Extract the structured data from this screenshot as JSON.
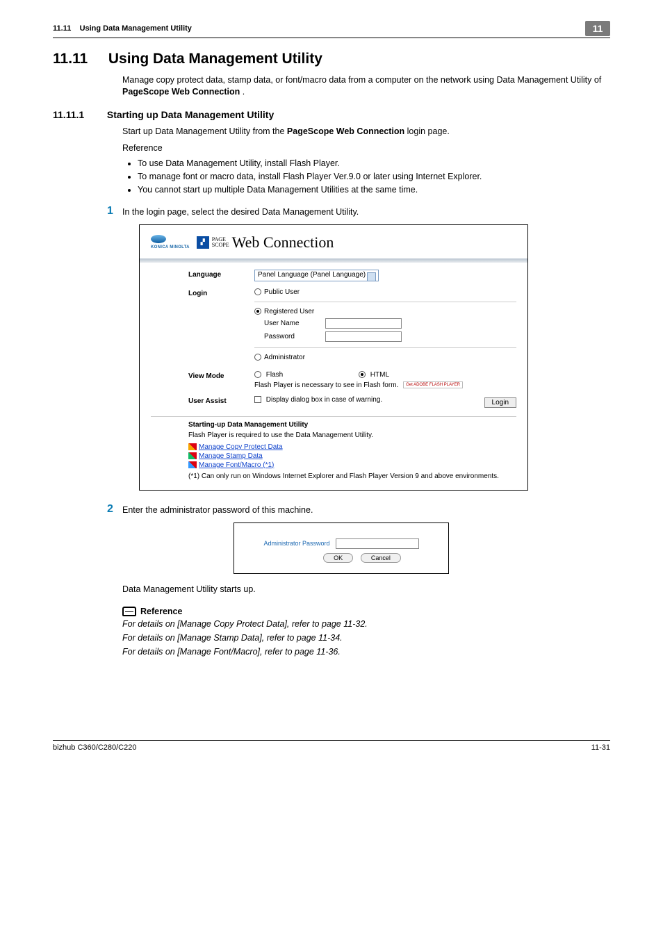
{
  "header": {
    "section_label": "11.11",
    "title_running": "Using Data Management Utility",
    "chapter_num": "11"
  },
  "section": {
    "number": "11.11",
    "title": "Using Data Management Utility",
    "intro": "Manage copy protect data, stamp data, or font/macro data from a computer on the network using Data Management Utility of ",
    "intro_bold": "PageScope Web Connection",
    "intro_end": "."
  },
  "subsection": {
    "number": "11.11.1",
    "title": "Starting up Data Management Utility",
    "lead_a": "Start up Data Management Utility from the ",
    "lead_b": "PageScope Web Connection",
    "lead_c": " login page.",
    "reference_label": "Reference",
    "bullets": [
      "To use Data Management Utility, install Flash Player.",
      "To manage font or macro data, install Flash Player Ver.9.0 or later using Internet Explorer.",
      "You cannot start up multiple Data Management Utilities at the same time."
    ]
  },
  "steps": {
    "s1": {
      "num": "1",
      "text": "In the login page, select the desired Data Management Utility."
    },
    "s2": {
      "num": "2",
      "text": "Enter the administrator password of this machine."
    }
  },
  "screenshot1": {
    "logo_brand": "KONICA MINOLTA",
    "ps_line1": "PAGE",
    "ps_line2": "SCOPE",
    "wc": "Web Connection",
    "language_label": "Language",
    "language_value": "Panel Language (Panel Language)",
    "login_label": "Login",
    "login_public": "Public User",
    "login_registered": "Registered User",
    "username_label": "User Name",
    "password_label": "Password",
    "login_admin": "Administrator",
    "viewmode_label": "View Mode",
    "vm_flash": "Flash",
    "vm_html": "HTML",
    "vm_note": "Flash Player is necessary to see in Flash form.",
    "flash_badge": "Get ADOBE FLASH PLAYER",
    "userassist_label": "User Assist",
    "userassist_chk": "Display dialog box in case of warning.",
    "login_btn": "Login",
    "dmu_title": "Starting-up Data Management Utility",
    "dmu_note": "Flash Player is required to use the Data Management Utility.",
    "dmu_links": [
      "Manage Copy Protect Data",
      "Manage Stamp Data",
      "Manage Font/Macro (*1)"
    ],
    "dmu_foot": "(*1) Can only run on Windows Internet Explorer and Flash Player Version 9 and above environments."
  },
  "screenshot2": {
    "admin_label": "Administrator Password",
    "ok": "OK",
    "cancel": "Cancel"
  },
  "after_s2": "Data Management Utility starts up.",
  "reference_block": {
    "heading": "Reference",
    "lines": [
      "For details on [Manage Copy Protect Data], refer to page 11-32.",
      "For details on [Manage Stamp Data], refer to page 11-34.",
      "For details on [Manage Font/Macro], refer to page 11-36."
    ]
  },
  "footer": {
    "left": "bizhub C360/C280/C220",
    "right": "11-31"
  }
}
